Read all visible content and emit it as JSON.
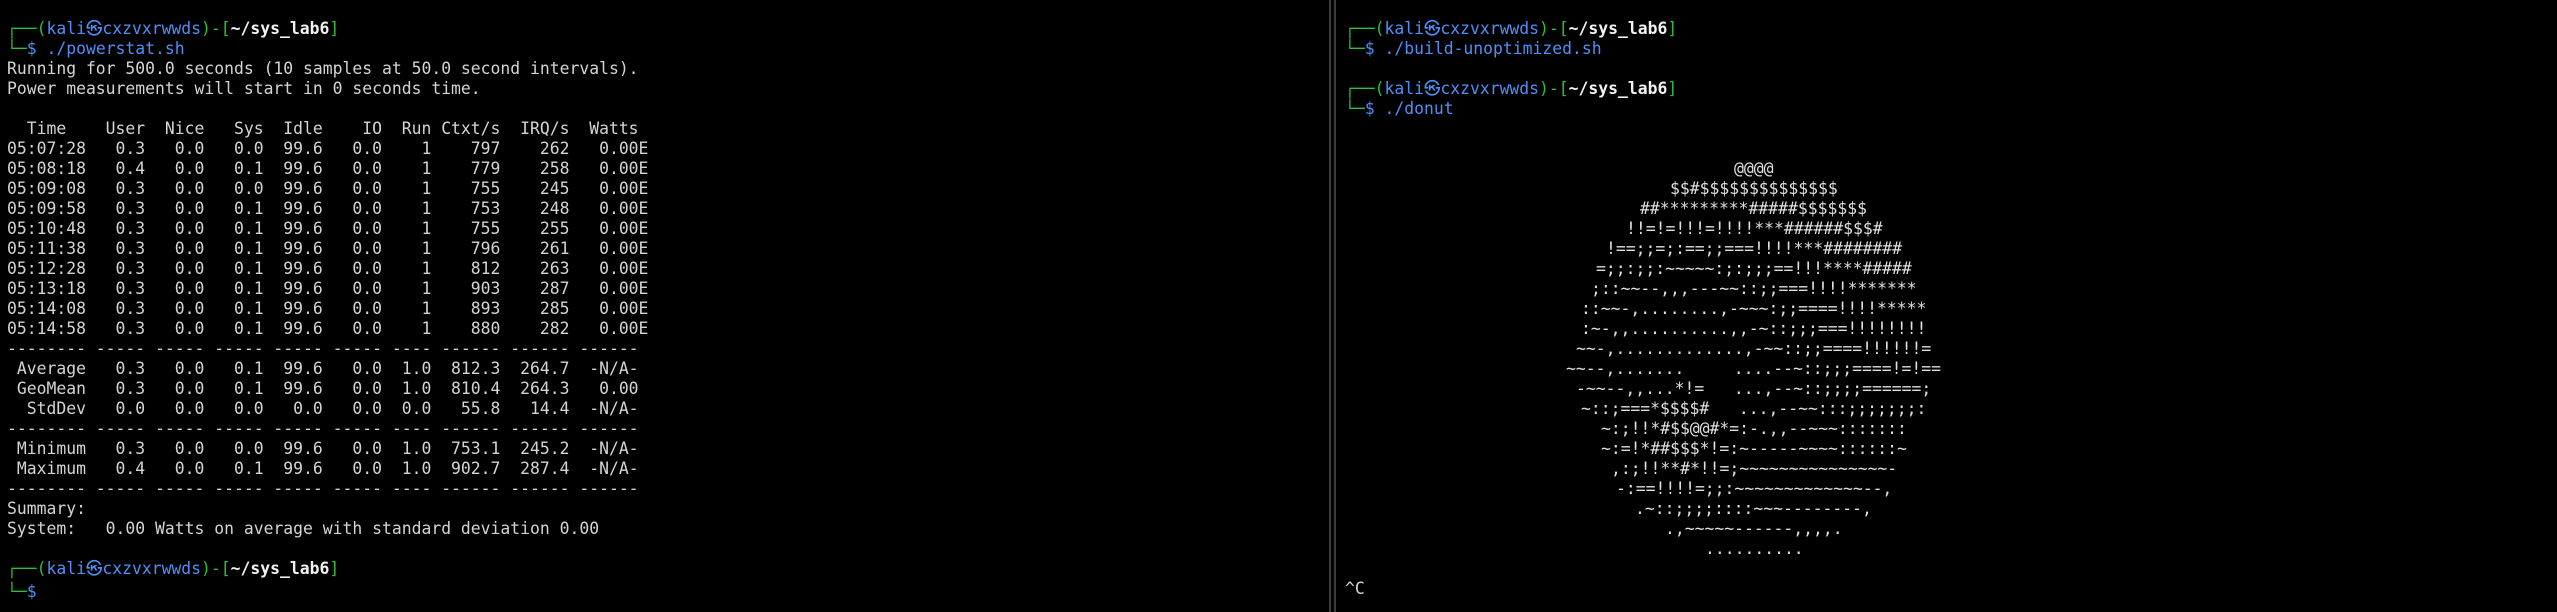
{
  "colors": {
    "background": "#000000",
    "prompt_frame": "#2fbf3c",
    "user_host": "#4f8ff7",
    "text": "#d4d4d4"
  },
  "prompt": {
    "open": "┌──(",
    "user": "kali",
    "at": "㉿",
    "host": "cxzvxrwwds",
    "mid": ")-[",
    "path": "~/sys_lab6",
    "close": "]",
    "second": "└─",
    "dollar": "$"
  },
  "left": {
    "cmd1": " ./powerstat.sh",
    "intro": [
      "Running for 500.0 seconds (10 samples at 50.0 second intervals).",
      "Power measurements will start in 0 seconds time."
    ],
    "header": "  Time    User  Nice   Sys  Idle    IO  Run Ctxt/s  IRQ/s  Watts",
    "rows": [
      "05:07:28   0.3   0.0   0.0  99.6   0.0    1    797    262   0.00E",
      "05:08:18   0.4   0.0   0.1  99.6   0.0    1    779    258   0.00E",
      "05:09:08   0.3   0.0   0.0  99.6   0.0    1    755    245   0.00E",
      "05:09:58   0.3   0.0   0.1  99.6   0.0    1    753    248   0.00E",
      "05:10:48   0.3   0.0   0.1  99.6   0.0    1    755    255   0.00E",
      "05:11:38   0.3   0.0   0.1  99.6   0.0    1    796    261   0.00E",
      "05:12:28   0.3   0.0   0.1  99.6   0.0    1    812    263   0.00E",
      "05:13:18   0.3   0.0   0.1  99.6   0.0    1    903    287   0.00E",
      "05:14:08   0.3   0.0   0.1  99.6   0.0    1    893    285   0.00E",
      "05:14:58   0.3   0.0   0.1  99.6   0.0    1    880    282   0.00E"
    ],
    "separator": "-------- ----- ----- ----- ----- ----- ---- ------ ------ ------",
    "stats1": [
      " Average   0.3   0.0   0.1  99.6   0.0  1.0  812.3  264.7  -N/A-",
      " GeoMean   0.3   0.0   0.1  99.6   0.0  1.0  810.4  264.3   0.00",
      "  StdDev   0.0   0.0   0.0   0.0   0.0  0.0   55.8   14.4  -N/A-"
    ],
    "stats2": [
      " Minimum   0.3   0.0   0.0  99.6   0.0  1.0  753.1  245.2  -N/A-",
      " Maximum   0.4   0.0   0.1  99.6   0.0  1.0  902.7  287.4  -N/A-"
    ],
    "summary": [
      "Summary:",
      "System:   0.00 Watts on average with standard deviation 0.00"
    ]
  },
  "right": {
    "cmd1": " ./build-unoptimized.sh",
    "cmd2": " ./donut",
    "donut": [
      "@@@@",
      "$$#$$$$$$$$$$$$$$",
      "##*********#####$$$$$$$",
      "!!=!=!!!=!!!!***######$$$#",
      "!==;;=;:==;;===!!!!***########",
      "=;;:;;:~~~~~:;:;;;==!!!****#####",
      ";::~~--,,,---~~::;;===!!!!*******",
      "::~~-,........,-~~~:;;====!!!!*****",
      ":~-,,..........,,-~::;;;===!!!!!!!!",
      "~~-,.............,-~~::;;====!!!!!!=",
      "~~--,.......     ....--~::;;;====!=!==",
      "-~~--,,...*!=   ...,--~::;;;;======;",
      "~::;===*$$$$#   ...,--~~:::;;;;;;;:",
      "~:;!!*#$$@@#*=:-.,,--~~~:::::::",
      "~:=!*##$$$*!=:~-----~~~~::::::~",
      ",:;!!**#*!!=;~~~~~~~~~~~~~~~-",
      "-:==!!!!=;;:~~~~~~~~~~~~~--,",
      ".~::;;;;::::~~~--------,",
      ".,~~~~~------,,,,.",
      ".........."
    ],
    "interrupt": "^C"
  }
}
